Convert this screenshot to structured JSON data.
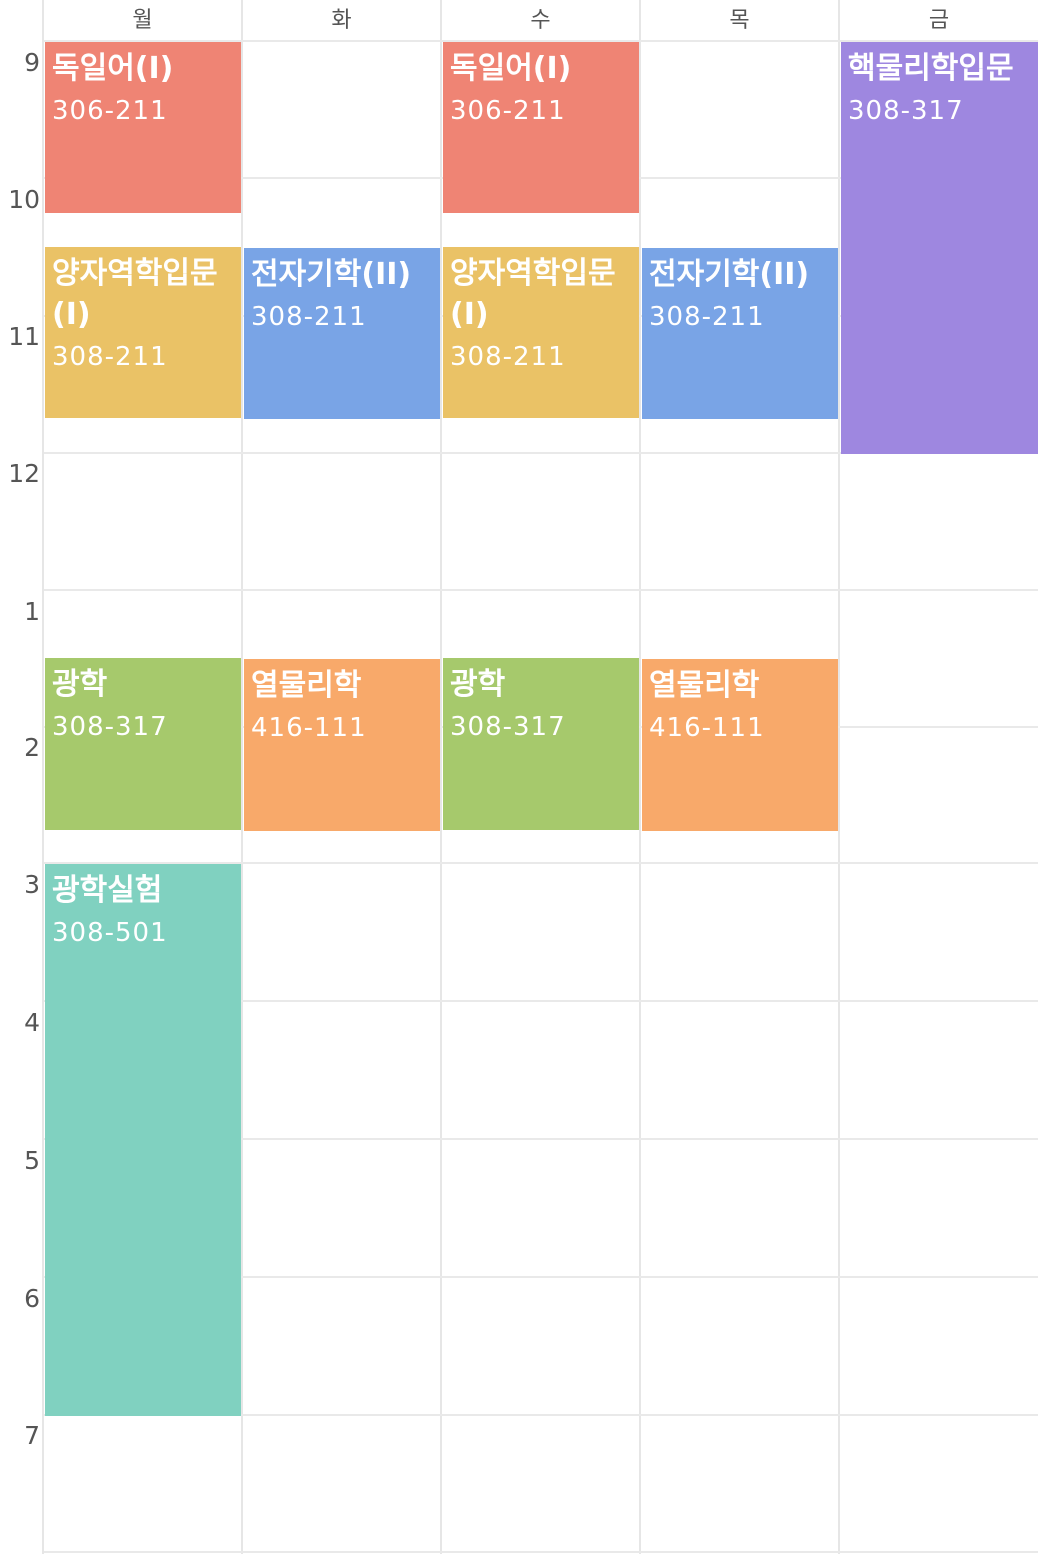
{
  "days": [
    "월",
    "화",
    "수",
    "목",
    "금"
  ],
  "hours": [
    "9",
    "10",
    "11",
    "12",
    "1",
    "2",
    "3",
    "4",
    "5",
    "6",
    "7"
  ],
  "courses": [
    {
      "name": "독일어(I)",
      "room": "306-211",
      "color": "#ef8474"
    },
    {
      "name": "양자역학입문(I)",
      "room": "308-211",
      "color": "#eac266"
    },
    {
      "name": "광학",
      "room": "308-317",
      "color": "#a6c96c"
    },
    {
      "name": "광학실험",
      "room": "308-501",
      "color": "#80d1c0"
    },
    {
      "name": "전자기학(II)",
      "room": "308-211",
      "color": "#79a4e6"
    },
    {
      "name": "열물리학",
      "room": "416-111",
      "color": "#f8a96a"
    },
    {
      "name": "독일어(I)",
      "room": "306-211",
      "color": "#ef8474"
    },
    {
      "name": "양자역학입문(I)",
      "room": "308-211",
      "color": "#eac266"
    },
    {
      "name": "광학",
      "room": "308-317",
      "color": "#a6c96c"
    },
    {
      "name": "전자기학(II)",
      "room": "308-211",
      "color": "#79a4e6"
    },
    {
      "name": "열물리학",
      "room": "416-111",
      "color": "#f8a96a"
    },
    {
      "name": "핵물리학입문",
      "room": "308-317",
      "color": "#9e87e0"
    }
  ]
}
